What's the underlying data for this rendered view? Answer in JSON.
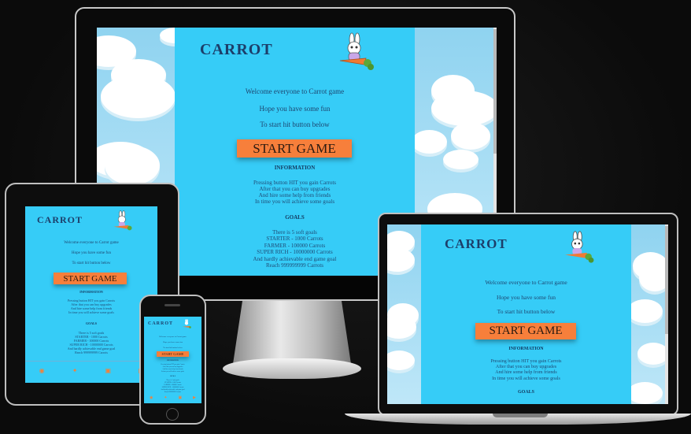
{
  "game": {
    "title": "CARROT",
    "welcome": "Welcome everyone to Carrot game",
    "hope": "Hope you have some fun",
    "instruction": "To start hit button below",
    "start_button": "START GAME",
    "information_heading": "INFORMATION",
    "info_lines": [
      "Pressing button HIT you gain Carrots",
      "After that you can buy upgrades",
      "And hire some help from friends",
      "In time you will achieve some goals"
    ],
    "goals_heading": "GOALS",
    "goal_lines": [
      "There is 5 soft goals",
      "STARTER - 1000 Carrots",
      "FARMER - 100000 Carrots",
      "SUPER RICH - 10000000 Carrots",
      "And hardly achievable end game goal",
      "Reach 999999999 Carrots"
    ]
  },
  "footer_icons": [
    "facebook-icon",
    "twitter-icon",
    "instagram-icon",
    "youtube-icon"
  ],
  "colors": {
    "panel": "#36ccf7",
    "button": "#f77f3b",
    "sky": "#9fdcf4",
    "text": "#1a4270"
  }
}
